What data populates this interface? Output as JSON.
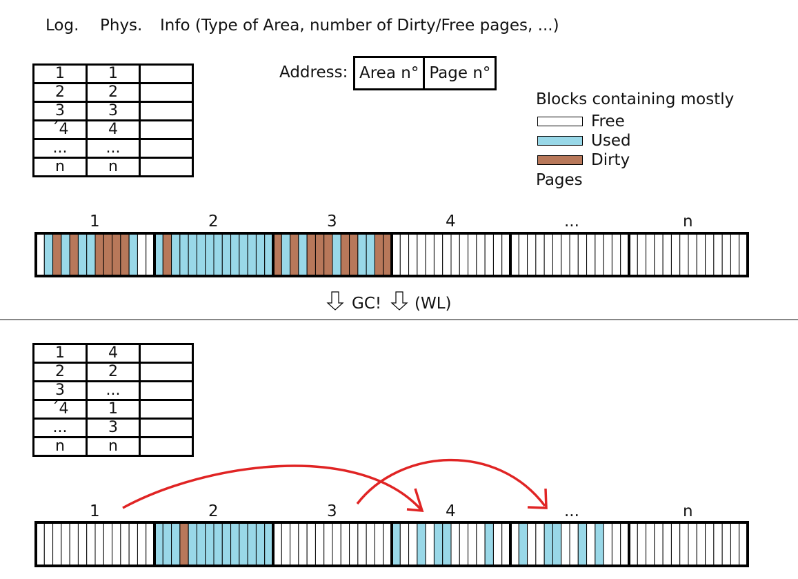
{
  "header": {
    "log_label": "Log.",
    "phys_label": "Phys.",
    "info_label": "Info (Type of Area, number of Dirty/Free pages, ...)"
  },
  "address": {
    "label": "Address:",
    "field1": "Area n°",
    "field2": "Page n°"
  },
  "legend": {
    "title": "Blocks containing mostly",
    "items": [
      {
        "label": "Free",
        "color": "#ffffff"
      },
      {
        "label": "Used",
        "color": "#99d8e8"
      },
      {
        "label": "Dirty",
        "color": "#b8785a"
      }
    ],
    "footer": "Pages"
  },
  "colors": {
    "free": "#ffffff",
    "used": "#99d8e8",
    "dirty": "#b8785a",
    "arrow": "#e02424"
  },
  "table_before": [
    [
      "1",
      "1"
    ],
    [
      "2",
      "2"
    ],
    [
      "3",
      "3"
    ],
    [
      "´4",
      "4"
    ],
    [
      "...",
      "..."
    ],
    [
      "n",
      "n"
    ]
  ],
  "table_after": [
    [
      "1",
      "4"
    ],
    [
      "2",
      "2"
    ],
    [
      "3",
      "..."
    ],
    [
      "´4",
      "1"
    ],
    [
      "...",
      "3"
    ],
    [
      "n",
      "n"
    ]
  ],
  "block_labels": [
    "1",
    "2",
    "3",
    "4",
    "...",
    "n"
  ],
  "gc_label": "GC!",
  "wl_label": "(WL)",
  "blocks_before": [
    "FUDUDUUDDDDUFF",
    "UDUUUUUUUUUUUU",
    "DUDUDDDUDDUUDD",
    "FFFFFFFFFFFFFF",
    "FFFFFFFFFFFFFF",
    "FFFFFFFFFFFFFF"
  ],
  "blocks_after": [
    "FFFFFFFFFFFFFF",
    "UUUDUUUUUUUUUU",
    "FFFFFFFFFFFFFF",
    "UFFUFUUFFFFUFF",
    "FUFFUUFFUFUFFF",
    "FFFFFFFFFFFFFF"
  ]
}
